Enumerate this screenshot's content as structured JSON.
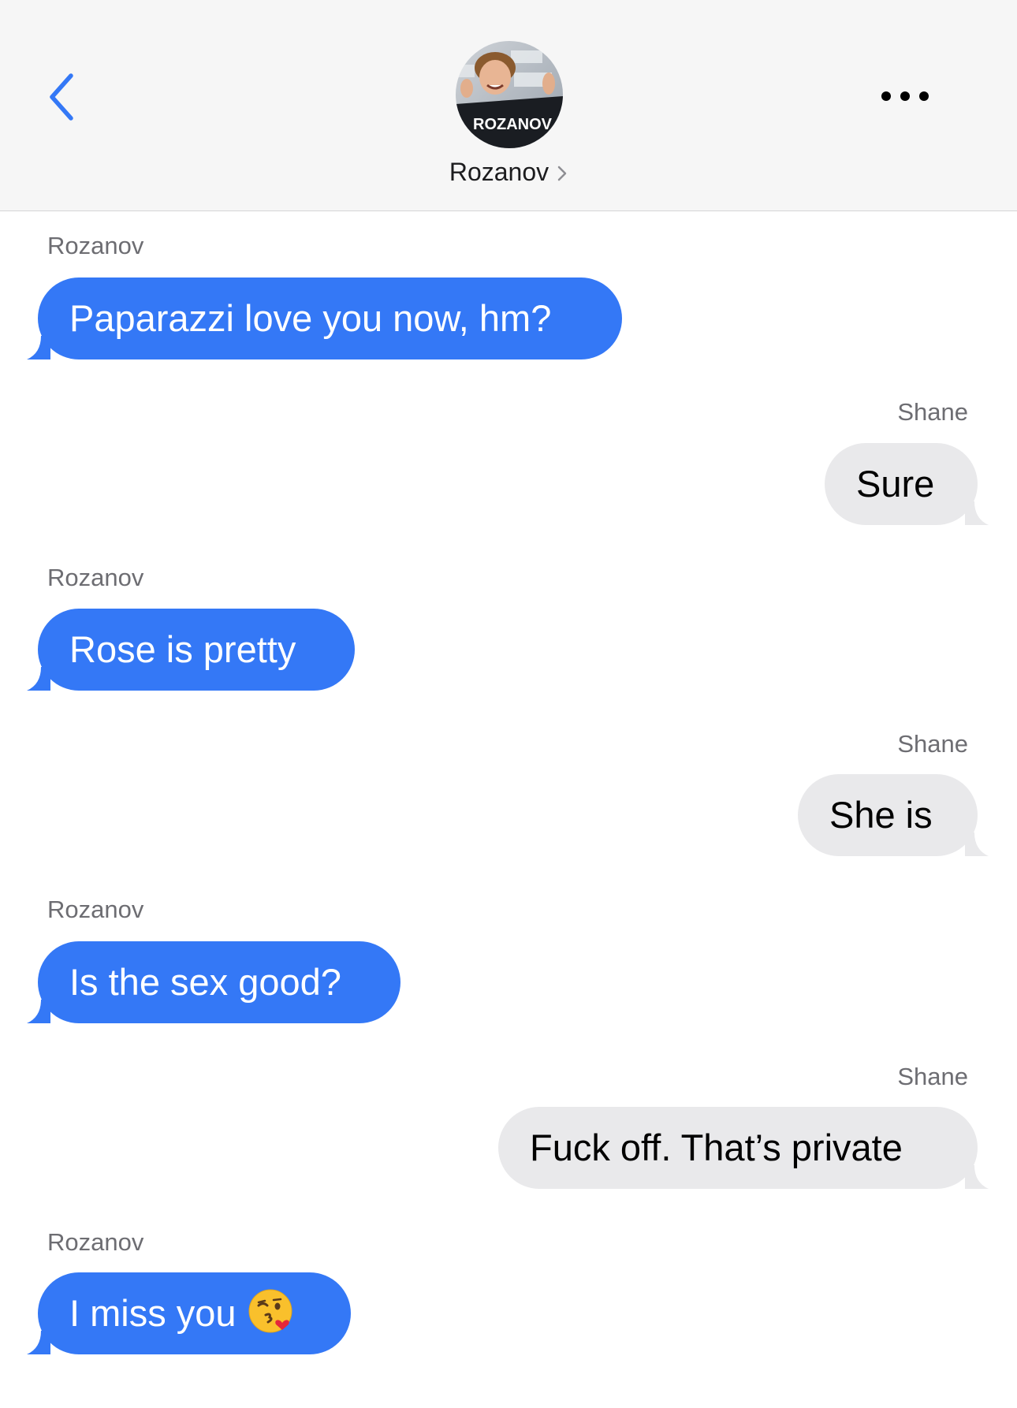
{
  "header": {
    "contact_name": "Rozanov",
    "avatar_jersey_text": "ROZANOV",
    "back_icon": "chevron-left-icon",
    "more_icon": "ellipsis-icon",
    "name_chevron_icon": "chevron-right-icon"
  },
  "colors": {
    "incoming_bubble": "#3478f6",
    "outgoing_bubble": "#e9e9eb",
    "accent": "#3478f6"
  },
  "messages": [
    {
      "sender": "Rozanov",
      "text": "Paparazzi love you now, hm?",
      "direction": "incoming"
    },
    {
      "sender": "Shane",
      "text": "Sure",
      "direction": "outgoing"
    },
    {
      "sender": "Rozanov",
      "text": "Rose is pretty",
      "direction": "incoming"
    },
    {
      "sender": "Shane",
      "text": "She is",
      "direction": "outgoing"
    },
    {
      "sender": "Rozanov",
      "text": "Is the sex good?",
      "direction": "incoming"
    },
    {
      "sender": "Shane",
      "text": "Fuck off. That’s private",
      "direction": "outgoing"
    },
    {
      "sender": "Rozanov",
      "text": "I miss you",
      "direction": "incoming",
      "emoji": "kissing-face-icon"
    }
  ]
}
